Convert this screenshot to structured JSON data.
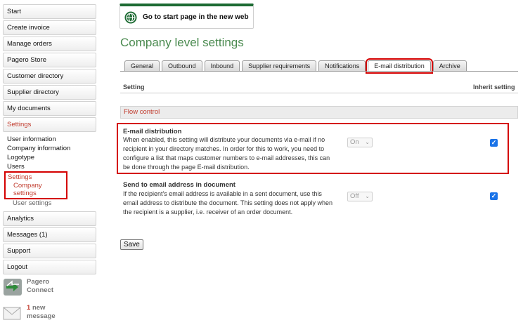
{
  "sidebar": {
    "top_items": [
      "Start",
      "Create invoice",
      "Manage orders",
      "Pagero Store",
      "Customer directory",
      "Supplier directory",
      "My documents"
    ],
    "settings_label": "Settings",
    "sub_items": [
      "User information",
      "Company information",
      "Logotype",
      "Users"
    ],
    "settings_group": {
      "label": "Settings",
      "company_settings": "Company settings"
    },
    "user_settings": "User settings",
    "bottom_items": [
      "Analytics",
      "Messages (1)",
      "Support",
      "Logout"
    ],
    "connect": {
      "line1": "Pagero",
      "line2": "Connect"
    },
    "message": {
      "count": "1",
      "line1": "new",
      "line2": "message"
    }
  },
  "start_page_link": "Go to start page in the new web",
  "page_title": "Company level settings",
  "tabs": [
    "General",
    "Outbound",
    "Inbound",
    "Supplier requirements",
    "Notifications",
    "E-mail distribution",
    "Archive"
  ],
  "active_tab": "E-mail distribution",
  "columns": {
    "setting": "Setting",
    "inherit": "Inherit setting"
  },
  "section": {
    "title": "Flow control"
  },
  "settings": [
    {
      "title": "E-mail distribution",
      "description": "When enabled, this setting will distribute your documents via e-mail if no recipient in your directory matches. In order for this to work, you need to configure a list that maps customer numbers to e-mail addresses, this can be done through the page E-mail distribution.",
      "value": "On",
      "inherit": true
    },
    {
      "title": "Send to email address in document",
      "description": "If the recipient's email address is available in a sent document, use this email address to distribute the document. This setting does not apply when the recipient is a supplier, i.e. receiver of an order document.",
      "value": "Off",
      "inherit": true
    }
  ],
  "save_label": "Save",
  "colors": {
    "brand_green": "#4a8a4f",
    "accent_red": "#c0392b",
    "highlight_red": "#d40000",
    "checkbox_blue": "#1a73e8"
  }
}
